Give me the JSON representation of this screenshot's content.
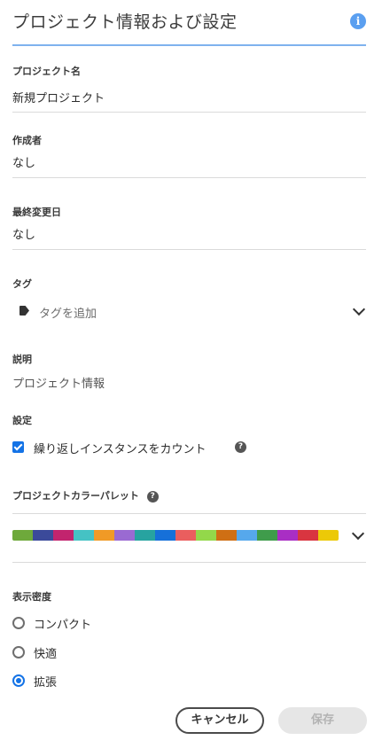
{
  "header": {
    "title": "プロジェクト情報および設定",
    "info_icon": "info-icon"
  },
  "project_name": {
    "label": "プロジェクト名",
    "value": "新規プロジェクト"
  },
  "created_by": {
    "label": "作成者",
    "value": "なし"
  },
  "last_modified": {
    "label": "最終変更日",
    "value": "なし"
  },
  "tags": {
    "label": "タグ",
    "placeholder": "タグを追加",
    "icon": "tag-icon"
  },
  "description": {
    "label": "説明",
    "value": "プロジェクト情報"
  },
  "settings": {
    "label": "設定",
    "repeat_instances": {
      "label": "繰り返しインスタンスをカウント",
      "checked": true
    }
  },
  "palette": {
    "label": "プロジェクトカラーパレット",
    "colors": [
      "#6ea93b",
      "#3b4a9a",
      "#c2246e",
      "#45c2c4",
      "#f09a26",
      "#9a6ad2",
      "#27a3a0",
      "#1670d9",
      "#ea5e5e",
      "#93d84a",
      "#cf6f14",
      "#56a8ec",
      "#3f9c4b",
      "#a92ec4",
      "#d93540",
      "#ecc907"
    ]
  },
  "density": {
    "label": "表示密度",
    "options": [
      {
        "label": "コンパクト",
        "selected": false
      },
      {
        "label": "快適",
        "selected": false
      },
      {
        "label": "拡張",
        "selected": true
      }
    ]
  },
  "footer": {
    "cancel_label": "キャンセル",
    "save_label": "保存"
  }
}
